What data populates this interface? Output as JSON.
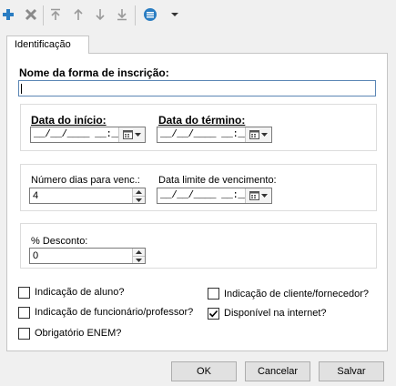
{
  "toolbar": {
    "add_icon": "plus-icon",
    "delete_icon": "x-icon",
    "move_top_icon": "arrow-top-icon",
    "move_up_icon": "arrow-up-icon",
    "move_down_icon": "arrow-down-icon",
    "move_bottom_icon": "arrow-bottom-icon",
    "menu_icon": "list-circle-icon",
    "accent_color": "#2a7dc2"
  },
  "tab": {
    "label": "Identificação"
  },
  "form": {
    "nome_label": "Nome da forma de inscrição:",
    "nome_value": "",
    "data_inicio_label": "Data do início:",
    "data_inicio_mask": "__/__/____ __:__",
    "data_termino_label": "Data do término:",
    "data_termino_mask": "__/__/____ __:__",
    "numero_dias_label": "Número dias para venc.:",
    "numero_dias_value": "4",
    "data_limite_label": "Data limite de vencimento:",
    "data_limite_mask": "__/__/____ __:__",
    "desconto_label": "% Desconto:",
    "desconto_value": "0"
  },
  "checkboxes": {
    "aluno": {
      "label": "Indicação de aluno?",
      "checked": false
    },
    "funcionario": {
      "label": "Indicação de funcionário/professor?",
      "checked": false
    },
    "enem": {
      "label": "Obrigatório ENEM?",
      "checked": false
    },
    "cliente": {
      "label": "Indicação de cliente/fornecedor?",
      "checked": false
    },
    "internet": {
      "label": "Disponível na internet?",
      "checked": true
    }
  },
  "buttons": {
    "ok": "OK",
    "cancel": "Cancelar",
    "save": "Salvar"
  }
}
